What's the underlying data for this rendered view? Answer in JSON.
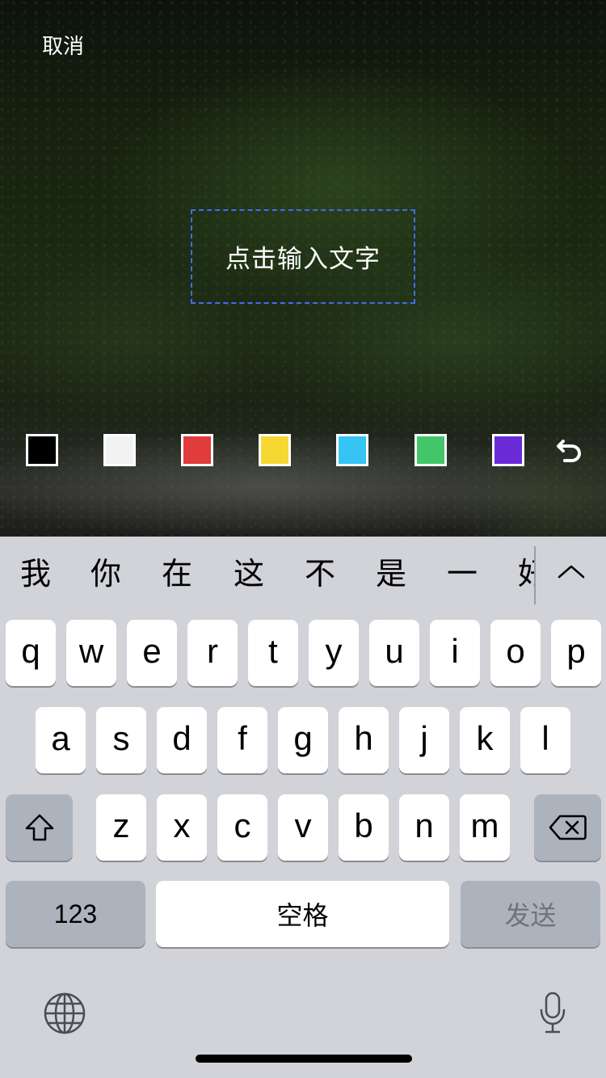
{
  "header": {
    "cancel_label": "取消"
  },
  "canvas": {
    "text_placeholder": "点击输入文字",
    "text_box_border_color": "#3f6ef0"
  },
  "palette": {
    "colors": [
      "#000000",
      "#f2f2f2",
      "#e03c3c",
      "#f6d832",
      "#35c4f3",
      "#43c669",
      "#6a2ad6"
    ],
    "undo_icon": "undo-arrow-icon"
  },
  "keyboard": {
    "candidates": [
      "我",
      "你",
      "在",
      "这",
      "不",
      "是",
      "一",
      "好"
    ],
    "expand_icon": "chevron-up-icon",
    "row1": [
      "q",
      "w",
      "e",
      "r",
      "t",
      "y",
      "u",
      "i",
      "o",
      "p"
    ],
    "row2": [
      "a",
      "s",
      "d",
      "f",
      "g",
      "h",
      "j",
      "k",
      "l"
    ],
    "row3": [
      "z",
      "x",
      "c",
      "v",
      "b",
      "n",
      "m"
    ],
    "shift_icon": "shift-icon",
    "delete_icon": "backspace-icon",
    "numbers_label": "123",
    "space_label": "空格",
    "send_label": "发送",
    "globe_icon": "globe-icon",
    "mic_icon": "microphone-icon"
  }
}
